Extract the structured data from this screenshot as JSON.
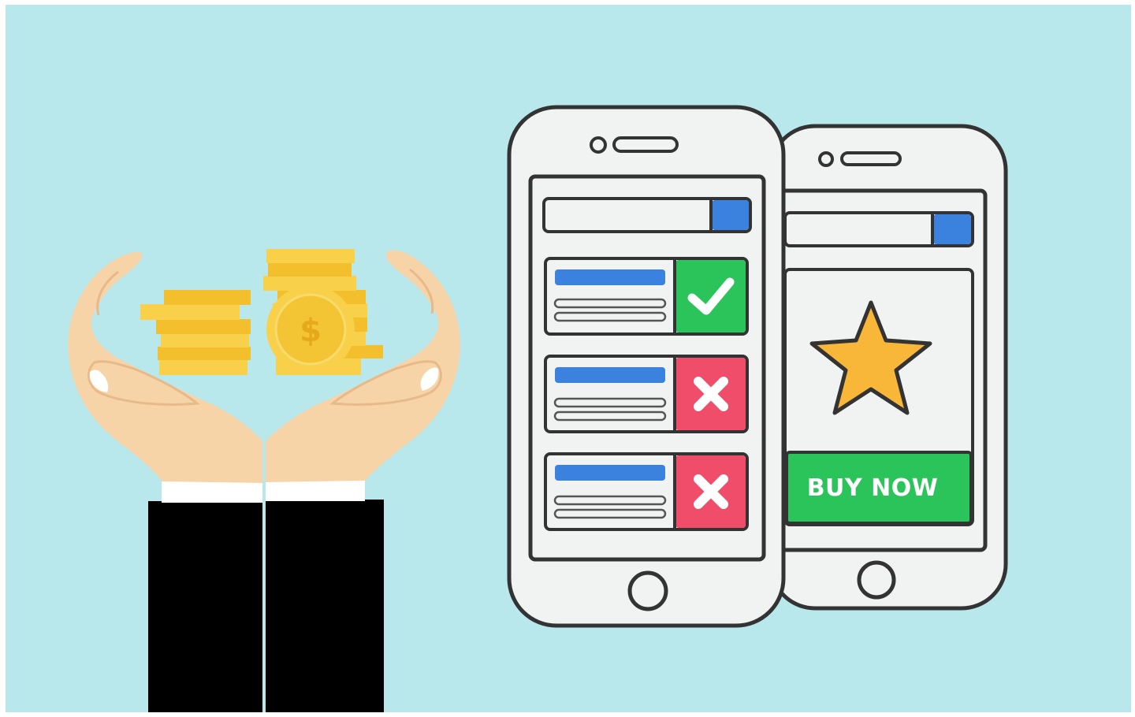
{
  "illustration": {
    "coin_symbol": "$",
    "buy_button_label": "BUY NOW",
    "colors": {
      "background": "#b9e8ec",
      "coin": "#f9d04a",
      "coin_shade": "#f3bf2c",
      "skin": "#f7d4a7",
      "sleeve": "#000000",
      "cuff": "#ffffff",
      "phone_body": "#f1f3f3",
      "outline": "#333333",
      "accent_blue": "#3b82df",
      "accept_green": "#2bc45a",
      "reject_red": "#ef4d6a",
      "star": "#f9b73a"
    },
    "list_items": [
      {
        "status": "accepted",
        "icon": "check-icon"
      },
      {
        "status": "rejected",
        "icon": "x-icon"
      },
      {
        "status": "rejected",
        "icon": "x-icon"
      }
    ]
  }
}
